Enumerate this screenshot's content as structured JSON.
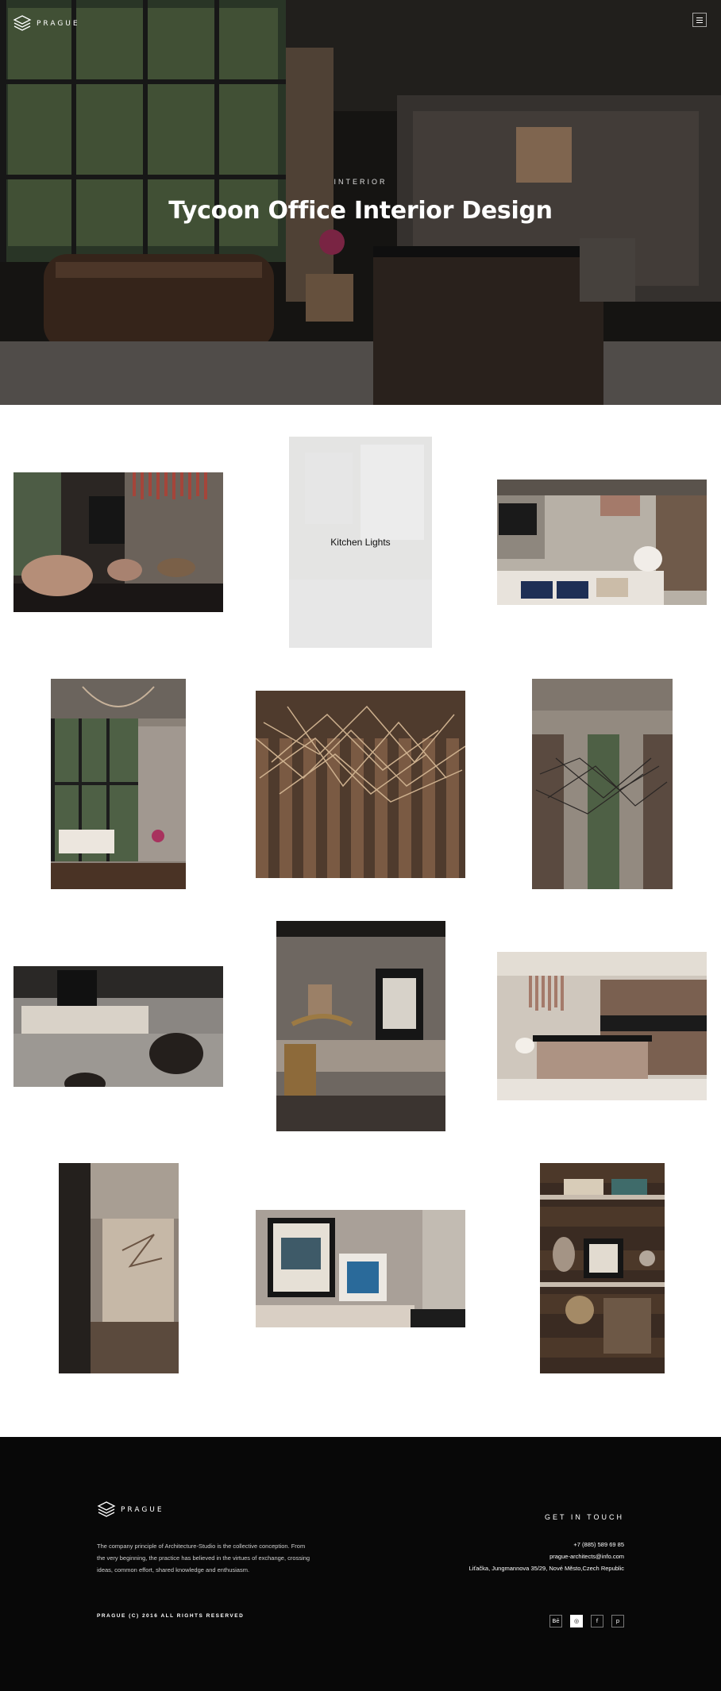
{
  "brand": {
    "name": "PRAGUE"
  },
  "hero": {
    "category": "INTERIOR",
    "title": "Tycoon Office Interior Design"
  },
  "gallery": {
    "hover_tile_title": "Kitchen Lights"
  },
  "footer": {
    "brand": "PRAGUE",
    "about": "The company principle of Architecture-Studio is the collective conception. From the very beginning, the practice has believed in the virtues of exchange, crossing ideas, common effort, shared knowledge and enthusiasm.",
    "get_in_touch": "GET IN TOUCH",
    "phone": "+7 (885) 589 69 85",
    "email": "prague-architects@info.com",
    "address": "Liťačka, Jungmannova 35/29, Nové Město,Czech Republic",
    "copyright": "PRAGUE (C) 2016 ALL RIGHTS RESERVED",
    "socials": [
      {
        "icon": "behance-icon",
        "glyph": "Bē"
      },
      {
        "icon": "dribbble-icon",
        "glyph": "◎"
      },
      {
        "icon": "facebook-icon",
        "glyph": "f"
      },
      {
        "icon": "pinterest-icon",
        "glyph": "p"
      }
    ]
  },
  "colors": {
    "hero_dark": "#1c1a18",
    "footer_bg": "#080808",
    "wood": "#5a4334",
    "accent_bronze": "#b08d6e"
  }
}
